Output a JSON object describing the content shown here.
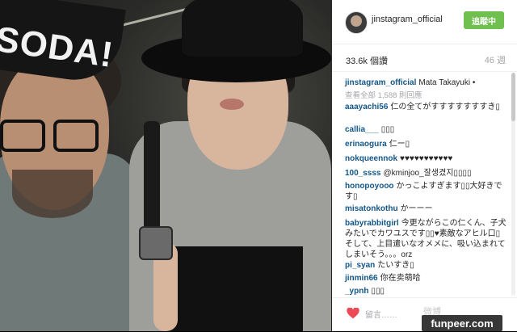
{
  "header": {
    "username": "jinstagram_official",
    "follow_label": "追蹤中"
  },
  "stats": {
    "views": "33.6k 個讚",
    "age": "46 週"
  },
  "caption": {
    "user": "jinstagram_official",
    "text": "Mata Takayuki •"
  },
  "load_more": "查看全部 1,588 則回應",
  "comments": [
    {
      "user": "aaayachi56",
      "text": "仁の全てがすすすすすすすき▯"
    },
    {
      "user": "callia___",
      "text": "▯▯▯"
    },
    {
      "user": "erinaogura",
      "text": "仁ー▯"
    },
    {
      "user": "nokqueennok",
      "text": "♥♥♥♥♥♥♥♥♥♥♥"
    },
    {
      "user": "100_ssss",
      "text": "@kminjoo_잘생겼지▯▯▯▯"
    },
    {
      "user": "honopoyooo",
      "text": "かっこよすぎます▯▯大好きです▯"
    },
    {
      "user": "misatonkothu",
      "text": "かーーー"
    },
    {
      "user": "babyrabbitgirl",
      "text": "今更ながらこの仁くん、子犬みたいでカワユスです▯▯♥素敵なアヒル口▯そして、上目遣いなオメメに、吸い込まれてしまいそう。。。orz"
    },
    {
      "user": "pi_syan",
      "text": "たいすき▯"
    },
    {
      "user": "jinmin66",
      "text": "你在卖萌哈"
    },
    {
      "user": "_ypnh",
      "text": "▯▯▯"
    }
  ],
  "footer": {
    "comment_placeholder": "留言……",
    "weibo_text": "微博"
  },
  "photo": {
    "cap_text": "SODA!"
  },
  "watermark": "funpeer.com",
  "colors": {
    "follow_green": "#70c050",
    "username_blue": "#125688",
    "heart_red": "#ed4956"
  }
}
